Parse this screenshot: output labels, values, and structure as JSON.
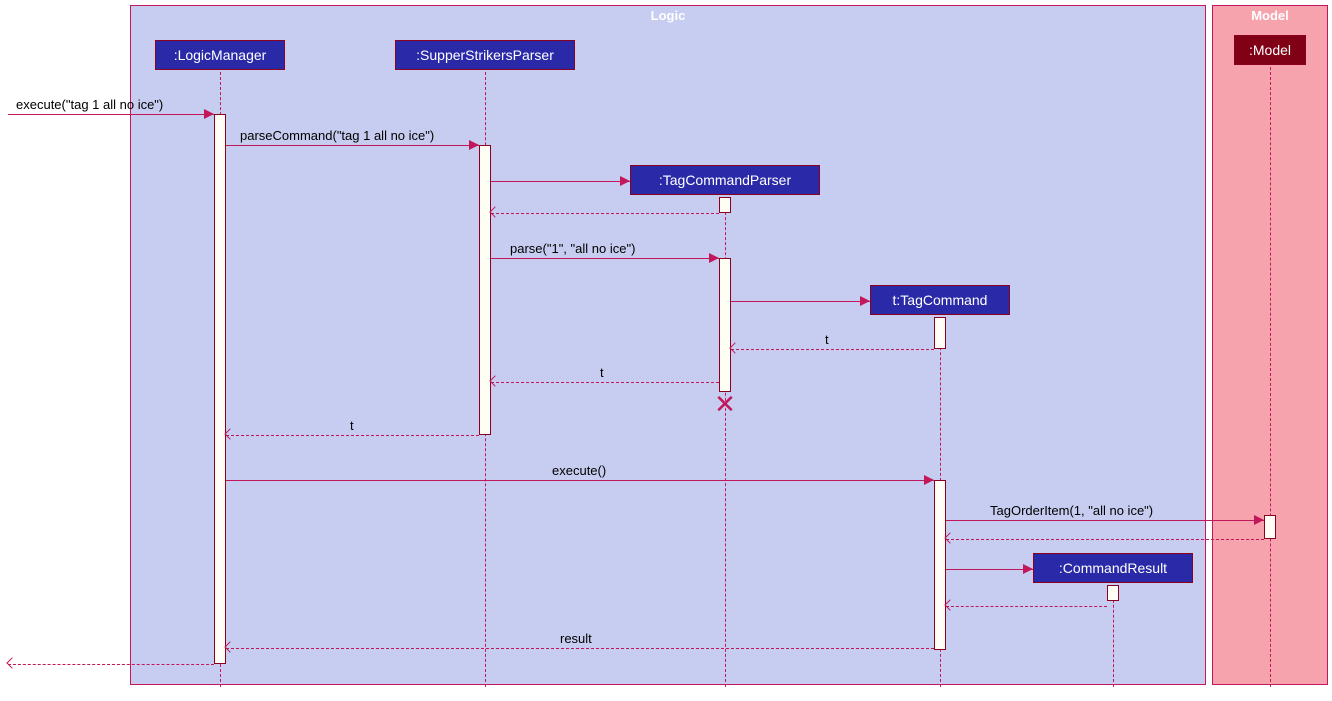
{
  "frames": {
    "logic": "Logic",
    "model": "Model"
  },
  "participants": {
    "logicManager": ":LogicManager",
    "parser": ":SupperStrikersParser",
    "tagCmdParser": ":TagCommandParser",
    "tagCmd": "t:TagCommand",
    "cmdResult": ":CommandResult",
    "model": ":Model"
  },
  "messages": {
    "m1": "execute(\"tag 1 all no ice\")",
    "m2": "parseCommand(\"tag 1 all no ice\")",
    "m3": "parse(\"1\", \"all no ice\")",
    "m4": "t",
    "m5": "t",
    "m6": "t",
    "m7": "execute()",
    "m8": "TagOrderItem(1, \"all no ice\")",
    "m9": "result"
  },
  "chart_data": {
    "type": "sequence-diagram",
    "frames": [
      {
        "name": "Logic",
        "participants": [
          "LogicManager",
          "SupperStrikersParser",
          "TagCommandParser",
          "TagCommand",
          "CommandResult"
        ]
      },
      {
        "name": "Model",
        "participants": [
          "Model"
        ]
      }
    ],
    "participants": [
      {
        "id": "caller",
        "label": ""
      },
      {
        "id": "LogicManager",
        "label": ":LogicManager"
      },
      {
        "id": "SupperStrikersParser",
        "label": ":SupperStrikersParser"
      },
      {
        "id": "TagCommandParser",
        "label": ":TagCommandParser"
      },
      {
        "id": "TagCommand",
        "label": "t:TagCommand"
      },
      {
        "id": "CommandResult",
        "label": ":CommandResult"
      },
      {
        "id": "Model",
        "label": ":Model"
      }
    ],
    "messages": [
      {
        "from": "caller",
        "to": "LogicManager",
        "label": "execute(\"tag 1 all no ice\")",
        "type": "sync"
      },
      {
        "from": "LogicManager",
        "to": "SupperStrikersParser",
        "label": "parseCommand(\"tag 1 all no ice\")",
        "type": "sync"
      },
      {
        "from": "SupperStrikersParser",
        "to": "TagCommandParser",
        "label": "",
        "type": "create"
      },
      {
        "from": "TagCommandParser",
        "to": "SupperStrikersParser",
        "label": "",
        "type": "return"
      },
      {
        "from": "SupperStrikersParser",
        "to": "TagCommandParser",
        "label": "parse(\"1\", \"all no ice\")",
        "type": "sync"
      },
      {
        "from": "TagCommandParser",
        "to": "TagCommand",
        "label": "",
        "type": "create"
      },
      {
        "from": "TagCommand",
        "to": "TagCommandParser",
        "label": "t",
        "type": "return"
      },
      {
        "from": "TagCommandParser",
        "to": "SupperStrikersParser",
        "label": "t",
        "type": "return"
      },
      {
        "from": "TagCommandParser",
        "to": "TagCommandParser",
        "label": "",
        "type": "destroy"
      },
      {
        "from": "SupperStrikersParser",
        "to": "LogicManager",
        "label": "t",
        "type": "return"
      },
      {
        "from": "LogicManager",
        "to": "TagCommand",
        "label": "execute()",
        "type": "sync"
      },
      {
        "from": "TagCommand",
        "to": "Model",
        "label": "TagOrderItem(1, \"all no ice\")",
        "type": "sync"
      },
      {
        "from": "Model",
        "to": "TagCommand",
        "label": "",
        "type": "return"
      },
      {
        "from": "TagCommand",
        "to": "CommandResult",
        "label": "",
        "type": "create"
      },
      {
        "from": "CommandResult",
        "to": "TagCommand",
        "label": "",
        "type": "return"
      },
      {
        "from": "TagCommand",
        "to": "LogicManager",
        "label": "result",
        "type": "return"
      },
      {
        "from": "LogicManager",
        "to": "caller",
        "label": "",
        "type": "return"
      }
    ]
  }
}
